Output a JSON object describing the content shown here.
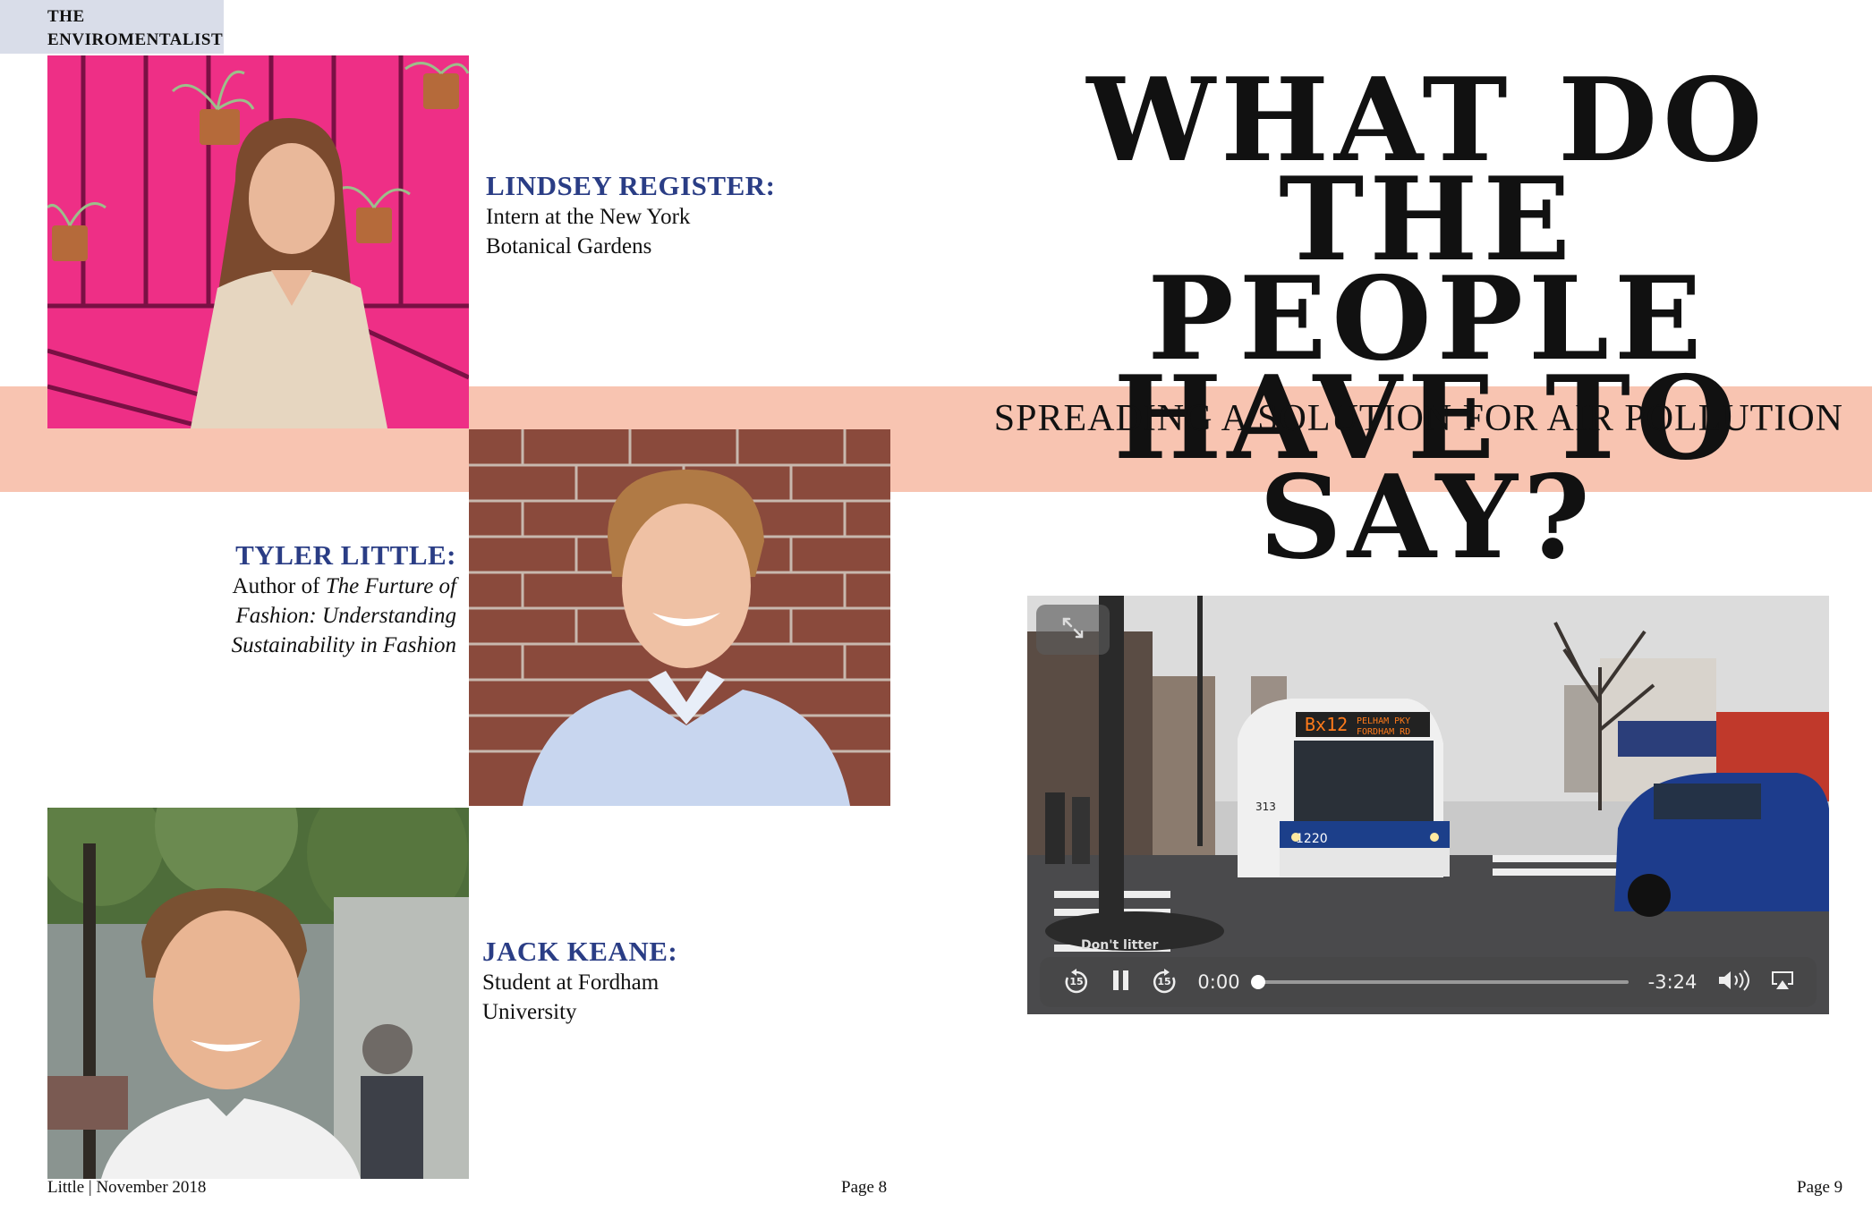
{
  "masthead": {
    "line1": "THE",
    "line2": "ENVIROMENTALIST"
  },
  "headline": {
    "line1": "WHAT DO",
    "line2": "THE PEOPLE",
    "line3": "HAVE TO SAY?"
  },
  "subhead": "SPREADING A SOLUTION FOR AIR POLLUTION",
  "people": [
    {
      "name": "LINDSEY REGISTER:",
      "role_line1": "Intern at the New York",
      "role_line2": "Botanical Gardens"
    },
    {
      "name": "TYLER LITTLE:",
      "role_prefix": "Author of ",
      "role_title_line1": "The Furture of",
      "role_title_line2": "Fashion: Understanding",
      "role_title_line3": "Sustainability in Fashion"
    },
    {
      "name": "JACK KEANE:",
      "role_line1": "Student at Fordham",
      "role_line2": "University"
    }
  ],
  "video": {
    "current_time": "0:00",
    "remaining_time": "-3:24",
    "progress": 0.0,
    "skip_back_label": "15",
    "skip_forward_label": "15",
    "bus_sign_route": "Bx12",
    "bus_sign_dest1": "PELHAM PKY",
    "bus_sign_dest2": "FORDHAM RD",
    "bus_number": "1220",
    "bus_front_code": "313",
    "bin_text": "Don't litter",
    "icons": {
      "expand": "expand-icon",
      "back": "skip-back-15-icon",
      "pause": "pause-icon",
      "forward": "skip-forward-15-icon",
      "volume": "volume-icon",
      "airplay": "airplay-icon"
    }
  },
  "footer": {
    "left": "Little | November 2018",
    "page_left": "Page 8",
    "page_right": "Page 9"
  },
  "colors": {
    "band": "#f8c4b1",
    "name_blue": "#2a3d85",
    "masthead_bg": "#d9dde9",
    "pink_wall": "#ee2f86"
  }
}
